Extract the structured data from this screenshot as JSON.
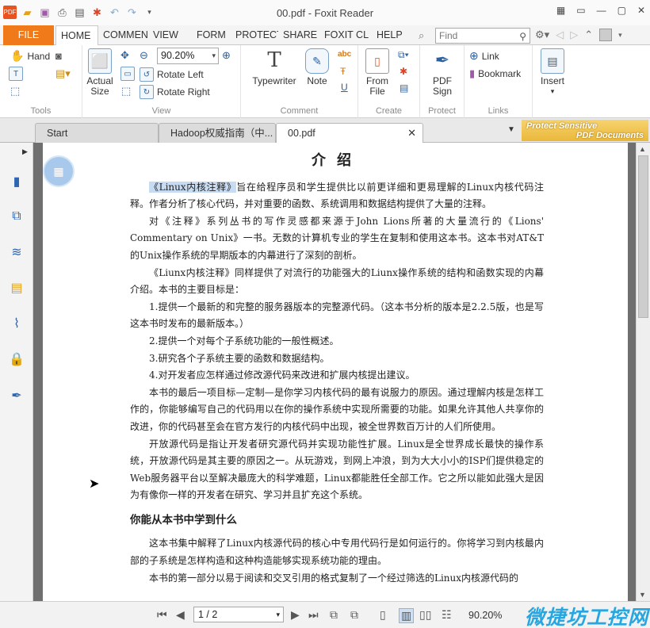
{
  "window": {
    "title": "00.pdf - Foxit Reader"
  },
  "ribbon_tabs": [
    "FILE",
    "HOME",
    "COMMENT",
    "VIEW",
    "FORM",
    "PROTECT",
    "SHARE",
    "FOXIT CLOUD",
    "HELP"
  ],
  "find": {
    "placeholder": "Find"
  },
  "tools": {
    "hand": "Hand",
    "group": "Tools"
  },
  "view_group": {
    "zoom": "90.20%",
    "actual_size": "Actual Size",
    "rotate_left": "Rotate Left",
    "rotate_right": "Rotate Right",
    "group": "View"
  },
  "comment_group": {
    "typewriter": "Typewriter",
    "note": "Note",
    "group": "Comment"
  },
  "create_group": {
    "from_file": "From File",
    "group": "Create"
  },
  "protect_group": {
    "pdf_sign": "PDF Sign",
    "group": "Protect"
  },
  "links_group": {
    "link": "Link",
    "bookmark": "Bookmark",
    "group": "Links"
  },
  "insert_group": {
    "insert": "Insert"
  },
  "doc_tabs": [
    "Start",
    "Hadoop权威指南（中...",
    "00.pdf"
  ],
  "promo": {
    "line1": "Protect Sensitive",
    "line2": "PDF Documents"
  },
  "document": {
    "heading": "介绍",
    "p1_hl": "《Linux内核注释》",
    "p1_rest": "旨在给程序员和学生提供比以前更详细和更易理解的Linux内核代码注释。作者分析了核心代码，并对重要的函数、系统调用和数据结构提供了大量的注释。",
    "p2": "对《注释》系列丛书的写作灵感都来源于John Lions所著的大量流行的《Lions' Commentary on Unix》一书。无数的计算机专业的学生在复制和使用这本书。这本书对AT&T的Unix操作系统的早期版本的内幕进行了深刻的剖析。",
    "p3": "《Liunx内核注释》同样提供了对流行的功能强大的Liunx操作系统的结构和函数实现的内幕介绍。本书的主要目标是：",
    "p4": "1.提供一个最新的和完整的服务器版本的完整源代码。（这本书分析的版本是2.2.5版，也是写这本书时发布的最新版本。）",
    "p5": "2.提供一个对每个子系统功能的一般性概述。",
    "p6": "3.研究各个子系统主要的函数和数据结构。",
    "p7": "4.对开发者应怎样通过修改源代码来改进和扩展内核提出建议。",
    "p8": "本书的最后一项目标—定制—是你学习内核代码的最有说服力的原因。通过理解内核是怎样工作的，你能够编写自己的代码用以在你的操作系统中实现所需要的功能。如果允许其他人共享你的改进，你的代码甚至会在官方发行的内核代码中出现，被全世界数百万计的人们所使用。",
    "p9": "开放源代码是指让开发者研究源代码并实现功能性扩展。Linux是全世界成长最快的操作系统，开放源代码是其主要的原因之一。从玩游戏，到网上冲浪，到为大大小小的ISP们提供稳定的Web服务器平台以至解决最庞大的科学难题，Linux都能胜任全部工作。它之所以能如此强大是因为有像你一样的开发者在研究、学习并且扩充这个系统。",
    "h2": "你能从本书中学到什么",
    "p10": "这本书集中解释了Linux内核源代码的核心中专用代码行是如何运行的。你将学习到内核最内部的子系统是怎样构造和这种构造能够实现系统功能的理由。",
    "p11": "本书的第一部分以易于阅读和交叉引用的格式复制了一个经过筛选的Linux内核源代码的"
  },
  "status": {
    "page": "1 / 2",
    "zoom": "90.20%"
  },
  "watermark": "微捷坊工控网"
}
